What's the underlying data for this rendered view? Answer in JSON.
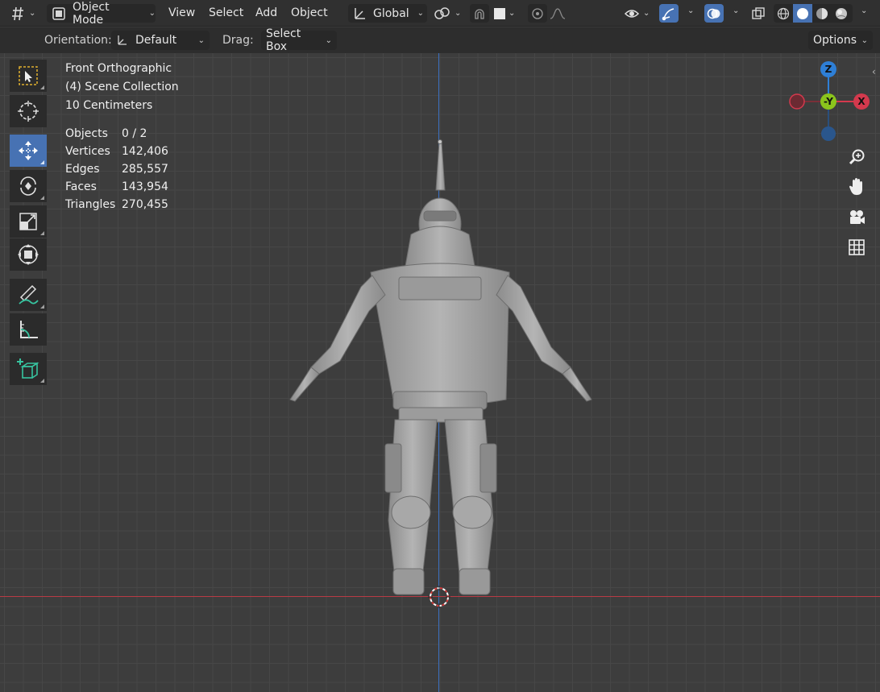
{
  "header": {
    "mode_label": "Object Mode",
    "menus": [
      "View",
      "Select",
      "Add",
      "Object"
    ],
    "transform_orientation": "Global",
    "options_label": "Options"
  },
  "toolsettings": {
    "orientation_label": "Orientation:",
    "orientation_value": "Default",
    "drag_label": "Drag:",
    "drag_value": "Select Box"
  },
  "viewport": {
    "view_name": "Front Orthographic",
    "collection": "(4) Scene Collection",
    "scale": "10 Centimeters",
    "stats": [
      {
        "label": "Objects",
        "value": "0 / 2"
      },
      {
        "label": "Vertices",
        "value": "142,406"
      },
      {
        "label": "Edges",
        "value": "285,557"
      },
      {
        "label": "Faces",
        "value": "143,954"
      },
      {
        "label": "Triangles",
        "value": "270,455"
      }
    ]
  },
  "gizmo": {
    "z_label": "Z",
    "y_label": "-Y",
    "x_label": "X",
    "colors": {
      "x": "#d4394d",
      "y": "#8bc41c",
      "z": "#2e7fd6"
    }
  },
  "icons": {
    "toolbar": [
      "select-box-icon",
      "cursor-icon",
      "move-icon",
      "rotate-icon",
      "scale-icon",
      "transform-icon",
      "annotate-icon",
      "measure-icon",
      "add-cube-icon"
    ],
    "nav": [
      "zoom-icon",
      "hand-icon",
      "camera-icon",
      "grid-icon"
    ]
  },
  "colors": {
    "accent": "#4772b3",
    "axis_x_line": "#b83a45",
    "axis_z_line": "#3b6fbf"
  }
}
